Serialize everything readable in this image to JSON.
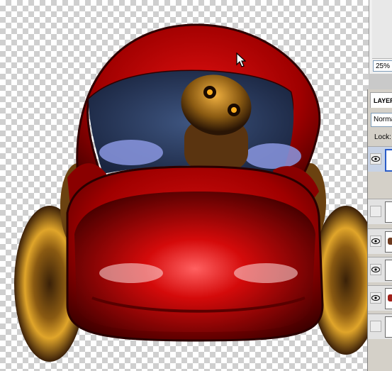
{
  "canvas": {
    "artwork": "red-car-with-driver"
  },
  "navigator": {
    "zoom": "25%"
  },
  "layers": {
    "tab_label": "LAYERS",
    "blend_mode": "Normal",
    "lock_label": "Lock:",
    "rows": [
      {
        "visible": true,
        "selected": true
      },
      {
        "visible": false,
        "selected": false
      },
      {
        "visible": true,
        "selected": false
      },
      {
        "visible": true,
        "selected": false
      },
      {
        "visible": true,
        "selected": false
      },
      {
        "visible": false,
        "selected": false
      }
    ]
  },
  "icons": {
    "cursor": "arrow-cursor-icon",
    "visibility": "eye-icon"
  },
  "colors": {
    "body_red": "#b00000",
    "window_blue": "#2b3e63",
    "wheel_gold": "#c98d1c"
  }
}
